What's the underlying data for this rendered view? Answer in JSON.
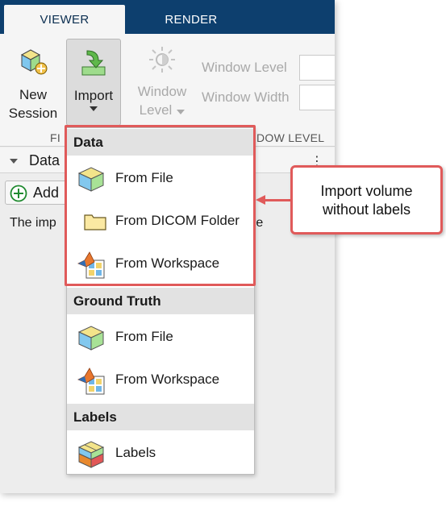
{
  "tabs": [
    {
      "label": "VIEWER"
    },
    {
      "label": "RENDER"
    }
  ],
  "ribbon": {
    "new_session_line1": "New",
    "new_session_line2": "Session",
    "import_label": "Import",
    "window_level_line1": "Window",
    "window_level_line2": "Level",
    "window_level_field": "Window Level",
    "window_width_field": "Window Width",
    "section_file": "FI",
    "section_window_level": "DOW LEVEL"
  },
  "panel": {
    "title": "Data",
    "add_label": "Add",
    "body_text": "The imp",
    "body_text_tail": "re"
  },
  "menu": {
    "sections": [
      {
        "header": "Data",
        "items": [
          {
            "label": "From File",
            "icon": "cube-icon"
          },
          {
            "label": "From DICOM Folder",
            "icon": "folder-icon"
          },
          {
            "label": "From Workspace",
            "icon": "workspace-icon"
          }
        ]
      },
      {
        "header": "Ground Truth",
        "items": [
          {
            "label": "From File",
            "icon": "cube-icon"
          },
          {
            "label": "From Workspace",
            "icon": "workspace-icon"
          }
        ]
      },
      {
        "header": "Labels",
        "items": [
          {
            "label": "Labels",
            "icon": "labels-icon"
          }
        ]
      }
    ]
  },
  "callout": {
    "line1": "Import volume",
    "line2": "without labels"
  },
  "colors": {
    "tabbar": "#0d3f6e",
    "annotation": "#e05a5a"
  }
}
